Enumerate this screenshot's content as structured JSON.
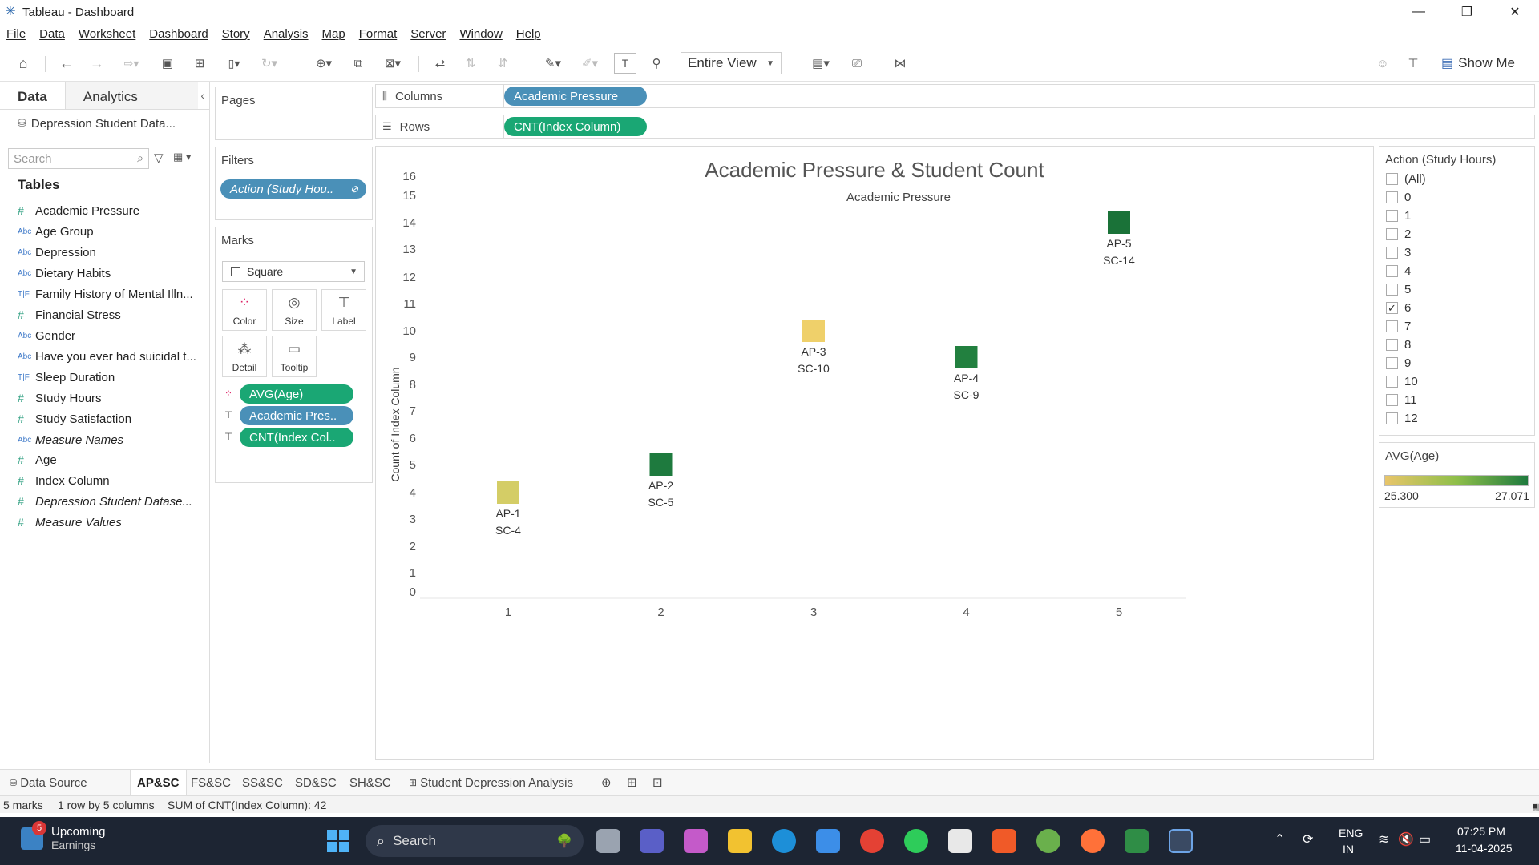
{
  "window": {
    "title": "Tableau - Dashboard"
  },
  "menu": [
    "File",
    "Data",
    "Worksheet",
    "Dashboard",
    "Story",
    "Analysis",
    "Map",
    "Format",
    "Server",
    "Window",
    "Help"
  ],
  "toolbar": {
    "view_mode": "Entire View",
    "show_me": "Show Me"
  },
  "left_pane": {
    "tab_data": "Data",
    "tab_analytics": "Analytics",
    "datasource": "Depression Student Data...",
    "search_placeholder": "Search",
    "tables_header": "Tables",
    "fields": [
      {
        "type": "#",
        "name": "Academic Pressure"
      },
      {
        "type": "Abc",
        "name": "Age Group"
      },
      {
        "type": "Abc",
        "name": "Depression"
      },
      {
        "type": "Abc",
        "name": "Dietary Habits"
      },
      {
        "type": "T|F",
        "name": "Family History of Mental Illn..."
      },
      {
        "type": "#",
        "name": "Financial Stress"
      },
      {
        "type": "Abc",
        "name": "Gender"
      },
      {
        "type": "Abc",
        "name": "Have you ever had suicidal t..."
      },
      {
        "type": "T|F",
        "name": "Sleep Duration"
      },
      {
        "type": "#",
        "name": "Study Hours"
      },
      {
        "type": "#",
        "name": "Study Satisfaction"
      },
      {
        "type": "Abc",
        "name": "Measure Names"
      }
    ],
    "measures": [
      {
        "type": "#",
        "name": "Age"
      },
      {
        "type": "#",
        "name": "Index Column"
      },
      {
        "type": "#",
        "name": "Depression Student Datase..."
      },
      {
        "type": "#",
        "name": "Measure Values"
      }
    ]
  },
  "shelves": {
    "pages_label": "Pages",
    "filters_label": "Filters",
    "filter_pill": "Action (Study Hou..",
    "marks_label": "Marks",
    "mark_type": "Square",
    "mark_buttons": [
      "Color",
      "Size",
      "Label",
      "Detail",
      "Tooltip"
    ],
    "mark_pills": [
      "AVG(Age)",
      "Academic Pres..",
      "CNT(Index Col.."
    ],
    "columns_label": "Columns",
    "columns_pill": "Academic Pressure",
    "rows_label": "Rows",
    "rows_pill": "CNT(Index Column)"
  },
  "chart_data": {
    "type": "scatter",
    "title": "Academic Pressure & Student Count",
    "subtitle": "Academic Pressure",
    "xlabel": "",
    "ylabel": "Count of Index Column",
    "y_ticks": [
      0,
      1,
      2,
      3,
      4,
      5,
      6,
      7,
      8,
      9,
      10,
      11,
      12,
      13,
      14,
      15,
      16
    ],
    "ylim": [
      0,
      16
    ],
    "x": [
      1,
      2,
      3,
      4,
      5
    ],
    "values": [
      4,
      5,
      10,
      9,
      14
    ],
    "labels": [
      [
        "AP-1",
        "SC-4"
      ],
      [
        "AP-2",
        "SC-5"
      ],
      [
        "AP-3",
        "SC-10"
      ],
      [
        "AP-4",
        "SC-9"
      ],
      [
        "AP-5",
        "SC-14"
      ]
    ],
    "colors": [
      "#d4cd66",
      "#1e7a3e",
      "#efd06a",
      "#22803f",
      "#1a7238"
    ]
  },
  "filter_card": {
    "title": "Action (Study Hours)",
    "options": [
      {
        "label": "(All)",
        "checked": false
      },
      {
        "label": "0",
        "checked": false
      },
      {
        "label": "1",
        "checked": false
      },
      {
        "label": "2",
        "checked": false
      },
      {
        "label": "3",
        "checked": false
      },
      {
        "label": "4",
        "checked": false
      },
      {
        "label": "5",
        "checked": false
      },
      {
        "label": "6",
        "checked": true
      },
      {
        "label": "7",
        "checked": false
      },
      {
        "label": "8",
        "checked": false
      },
      {
        "label": "9",
        "checked": false
      },
      {
        "label": "10",
        "checked": false
      },
      {
        "label": "11",
        "checked": false
      },
      {
        "label": "12",
        "checked": false
      }
    ]
  },
  "legend": {
    "title": "AVG(Age)",
    "min": "25.300",
    "max": "27.071"
  },
  "sheet_tabs": {
    "datasource": "Data Source",
    "tabs": [
      "AP&SC",
      "FS&SC",
      "SS&SC",
      "SD&SC",
      "SH&SC",
      "Student Depression Analysis"
    ],
    "active": "AP&SC"
  },
  "status": {
    "marks": "5 marks",
    "shape": "1 row by 5 columns",
    "sum": "SUM of CNT(Index Column): 42"
  },
  "taskbar": {
    "weather_badge": "5",
    "weather_title": "Upcoming",
    "weather_sub": "Earnings",
    "search": "Search",
    "lang1": "ENG",
    "lang2": "IN",
    "time": "07:25 PM",
    "date": "11-04-2025"
  }
}
